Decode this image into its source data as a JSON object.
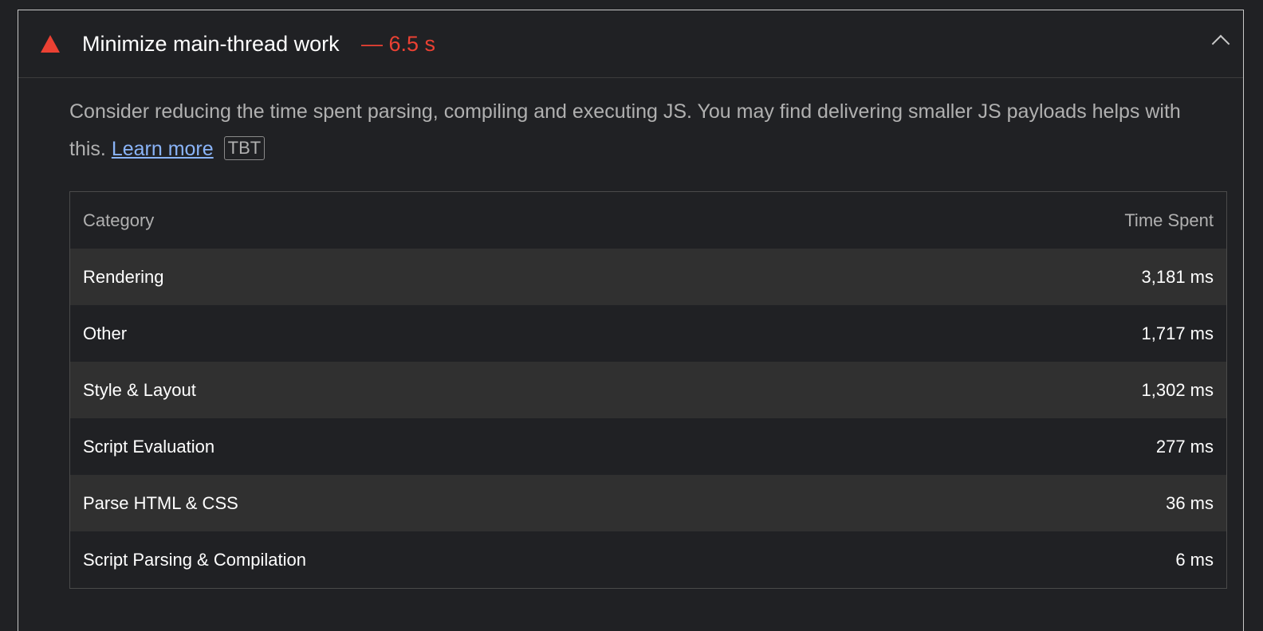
{
  "audit": {
    "title": "Minimize main-thread work",
    "display_value": "— 6.5 s",
    "status_color": "#eb4133",
    "status_icon": "fail-triangle-icon",
    "expanded_icon": "chevron-up-icon"
  },
  "description": {
    "text": "Consider reducing the time spent parsing, compiling and executing JS. You may find delivering smaller JS payloads helps with this.",
    "link_label": "Learn more",
    "tag": "TBT"
  },
  "table": {
    "headers": {
      "category": "Category",
      "time": "Time Spent"
    },
    "rows": [
      {
        "category": "Rendering",
        "time": "3,181 ms"
      },
      {
        "category": "Other",
        "time": "1,717 ms"
      },
      {
        "category": "Style & Layout",
        "time": "1,302 ms"
      },
      {
        "category": "Script Evaluation",
        "time": "277 ms"
      },
      {
        "category": "Parse HTML & CSS",
        "time": "36 ms"
      },
      {
        "category": "Script Parsing & Compilation",
        "time": "6 ms"
      }
    ]
  },
  "colors": {
    "background": "#202124",
    "alt_row": "#303030",
    "link": "#8ab4f8",
    "fail": "#eb4133"
  }
}
